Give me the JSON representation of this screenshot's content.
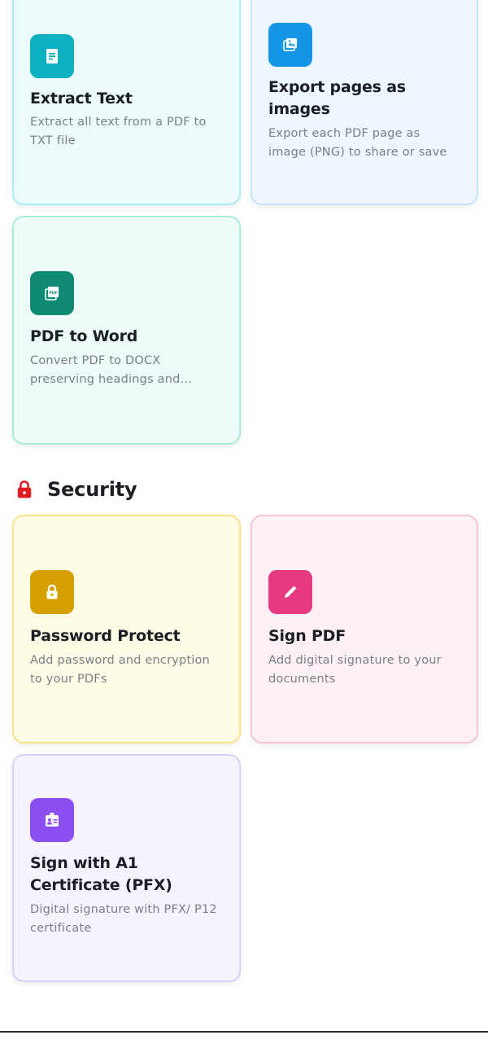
{
  "cards_top": [
    {
      "title": "Extract Text",
      "description": "Extract all text from a PDF to TXT file",
      "icon": "document-text-icon",
      "bg": "#ecfbfc",
      "border": "#a9eef0",
      "icon_bg": "#0fb0c2"
    },
    {
      "title": "Export pages as images",
      "description": "Export each PDF page as image (PNG) to share or save",
      "icon": "image-gallery-icon",
      "bg": "#eef6ff",
      "border": "#c9e2fb",
      "icon_bg": "#1595e3"
    },
    {
      "title": "PDF to Word",
      "description": "Convert PDF to DOCX preserving headings and formatting",
      "icon": "pdf-file-icon",
      "bg": "#edfcf8",
      "border": "#a8ecd9",
      "icon_bg": "#0f8a73"
    }
  ],
  "security": {
    "heading": "Security",
    "icon": "lock-icon",
    "accent": "#e11d24",
    "cards": [
      {
        "title": "Password Protect",
        "description": "Add password and encryption to your PDFs",
        "icon": "lock-icon",
        "bg": "#fefbe6",
        "border": "#fbe38a",
        "icon_bg": "#d6a005"
      },
      {
        "title": "Sign PDF",
        "description": "Add digital signature to your documents",
        "icon": "pencil-icon",
        "bg": "#fdf1f6",
        "border": "#f7c3d8",
        "icon_bg": "#e7397f"
      },
      {
        "title": "Sign with A1 Certificate (PFX)",
        "description": "Digital signature with PFX/ P12 certificate",
        "icon": "id-badge-icon",
        "bg": "#f6f3ff",
        "border": "#d9cffb",
        "icon_bg": "#8b4ef0"
      }
    ]
  }
}
